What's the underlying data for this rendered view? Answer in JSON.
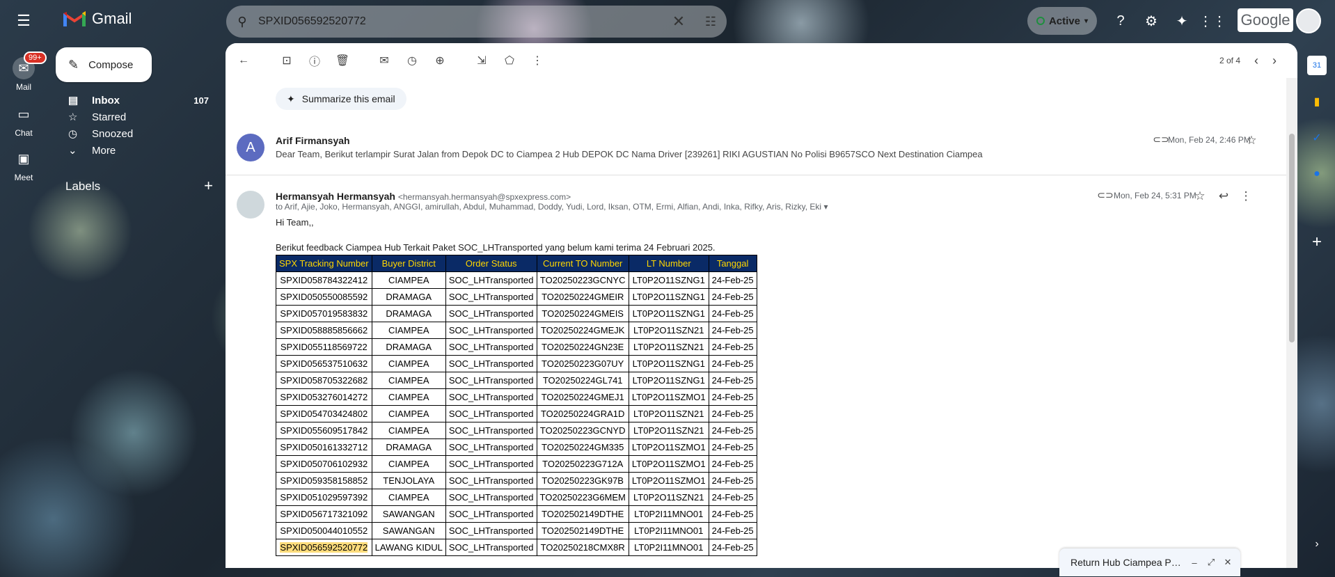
{
  "app": {
    "name": "Gmail"
  },
  "search": {
    "value": "SPXID056592520772"
  },
  "status": {
    "label": "Active"
  },
  "google_logo": "Google",
  "rail": {
    "mail": {
      "label": "Mail",
      "badge": "99+"
    },
    "chat": {
      "label": "Chat"
    },
    "meet": {
      "label": "Meet"
    }
  },
  "compose": {
    "label": "Compose"
  },
  "nav": [
    {
      "label": "Inbox",
      "count": "107",
      "icon": "inbox-icon"
    },
    {
      "label": "Starred",
      "count": "",
      "icon": "star-icon"
    },
    {
      "label": "Snoozed",
      "count": "",
      "icon": "clock-icon"
    },
    {
      "label": "More",
      "count": "",
      "icon": "chevron-down-icon"
    }
  ],
  "labels": {
    "title": "Labels"
  },
  "toolbar": {
    "pager": "2 of 4"
  },
  "summarize": {
    "label": "Summarize this email"
  },
  "message1": {
    "avatar_letter": "A",
    "sender": "Arif Firmansyah",
    "snippet": "Dear Team, Berikut terlampir Surat Jalan from Depok DC to Ciampea 2 Hub DEPOK DC Nama Driver [239261] RIKI AGUSTIAN No Polisi B9657SCO Next Destination Ciampea",
    "date": "Mon, Feb 24, 2:46 PM"
  },
  "message2": {
    "sender": "Hermansyah Hermansyah",
    "email": "<hermansyah.hermansyah@spxexpress.com>",
    "to": "to Arif, Ajie, Joko, Hermansyah, ANGGI, amirullah, Abdul, Muhammad, Doddy, Yudi, Lord, Iksan, OTM, Ermi, Alfian, Andi, Inka, Rifky, Aris, Rizky, Eki",
    "date": "Mon, Feb 24, 5:31 PM",
    "greeting": "Hi Team,,",
    "intro": "Berikut feedback Ciampea Hub Terkait Paket SOC_LHTransported yang belum kami terima 24 Februari 2025."
  },
  "table": {
    "headers": [
      "SPX Tracking Number",
      "Buyer District",
      "Order Status",
      "Current TO Number",
      "LT Number",
      "Tanggal"
    ],
    "rows": [
      [
        "SPXID058784322412",
        "CIAMPEA",
        "SOC_LHTransported",
        "TO20250223GCNYC",
        "LT0P2O11SZNG1",
        "24-Feb-25"
      ],
      [
        "SPXID050550085592",
        "DRAMAGA",
        "SOC_LHTransported",
        "TO20250224GMEIR",
        "LT0P2O11SZNG1",
        "24-Feb-25"
      ],
      [
        "SPXID057019583832",
        "DRAMAGA",
        "SOC_LHTransported",
        "TO20250224GMEIS",
        "LT0P2O11SZNG1",
        "24-Feb-25"
      ],
      [
        "SPXID058885856662",
        "CIAMPEA",
        "SOC_LHTransported",
        "TO20250224GMEJK",
        "LT0P2O11SZN21",
        "24-Feb-25"
      ],
      [
        "SPXID055118569722",
        "DRAMAGA",
        "SOC_LHTransported",
        "TO20250224GN23E",
        "LT0P2O11SZN21",
        "24-Feb-25"
      ],
      [
        "SPXID056537510632",
        "CIAMPEA",
        "SOC_LHTransported",
        "TO20250223G07UY",
        "LT0P2O11SZNG1",
        "24-Feb-25"
      ],
      [
        "SPXID058705322682",
        "CIAMPEA",
        "SOC_LHTransported",
        "TO20250224GL741",
        "LT0P2O11SZNG1",
        "24-Feb-25"
      ],
      [
        "SPXID053276014272",
        "CIAMPEA",
        "SOC_LHTransported",
        "TO20250224GMEJ1",
        "LT0P2O11SZMO1",
        "24-Feb-25"
      ],
      [
        "SPXID054703424802",
        "CIAMPEA",
        "SOC_LHTransported",
        "TO20250224GRA1D",
        "LT0P2O11SZN21",
        "24-Feb-25"
      ],
      [
        "SPXID055609517842",
        "CIAMPEA",
        "SOC_LHTransported",
        "TO20250223GCNYD",
        "LT0P2O11SZN21",
        "24-Feb-25"
      ],
      [
        "SPXID050161332712",
        "DRAMAGA",
        "SOC_LHTransported",
        "TO20250224GM335",
        "LT0P2O11SZMO1",
        "24-Feb-25"
      ],
      [
        "SPXID050706102932",
        "CIAMPEA",
        "SOC_LHTransported",
        "TO20250223G712A",
        "LT0P2O11SZMO1",
        "24-Feb-25"
      ],
      [
        "SPXID059358158852",
        "TENJOLAYA",
        "SOC_LHTransported",
        "TO20250223GK97B",
        "LT0P2O11SZMO1",
        "24-Feb-25"
      ],
      [
        "SPXID051029597392",
        "CIAMPEA",
        "SOC_LHTransported",
        "TO20250223G6MEM",
        "LT0P2O11SZN21",
        "24-Feb-25"
      ],
      [
        "SPXID056717321092",
        "SAWANGAN",
        "SOC_LHTransported",
        "TO202502149DTHE",
        "LT0P2I11MNO01",
        "24-Feb-25"
      ],
      [
        "SPXID050044010552",
        "SAWANGAN",
        "SOC_LHTransported",
        "TO202502149DTHE",
        "LT0P2I11MNO01",
        "24-Feb-25"
      ],
      [
        "SPXID056592520772",
        "LAWANG KIDUL",
        "SOC_LHTransported",
        "TO20250218CMX8R",
        "LT0P2I11MNO01",
        "24-Feb-25"
      ]
    ],
    "highlight_color": "#fddc7c",
    "header_bg": "#0a2a66",
    "header_fg": "#ffd600"
  },
  "draft": {
    "title": "Return Hub Ciampea Parcel Canc..."
  },
  "colors": {
    "accent": "#0b57d0",
    "badge": "#d93025"
  }
}
